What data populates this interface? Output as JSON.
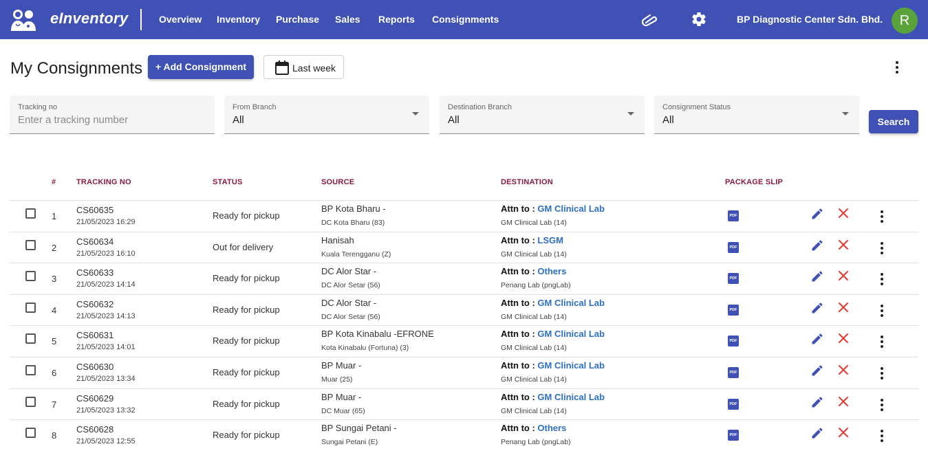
{
  "app": {
    "brand": "eInventory",
    "company": "BP Diagnostic Center Sdn. Bhd.",
    "avatar_initial": "R",
    "nav": [
      "Overview",
      "Inventory",
      "Purchase",
      "Sales",
      "Reports",
      "Consignments"
    ]
  },
  "page": {
    "title": "My Consignments",
    "add_button": "+ Add Consignment",
    "date_range": "Last week"
  },
  "filters": {
    "tracking_label": "Tracking no",
    "tracking_placeholder": "Enter a tracking number",
    "from_label": "From Branch",
    "from_value": "All",
    "dest_label": "Destination Branch",
    "dest_value": "All",
    "status_label": "Consignment Status",
    "status_value": "All",
    "search_button": "Search"
  },
  "table": {
    "headers": {
      "num": "#",
      "tracking": "TRACKING NO",
      "status": "STATUS",
      "source": "SOURCE",
      "destination": "DESTINATION",
      "slip": "PACKAGE SLIP"
    },
    "attn_prefix": "Attn to : ",
    "pdf_label": "PDF",
    "rows": [
      {
        "num": "1",
        "tracking": "CS60635",
        "date": "21/05/2023 16:29",
        "status": "Ready for pickup",
        "source": "BP Kota Bharu -",
        "source_branch": "DC Kota Bharu (83)",
        "attn": "GM Clinical Lab",
        "dest_branch": "GM Clinical Lab (14)"
      },
      {
        "num": "2",
        "tracking": "CS60634",
        "date": "21/05/2023 16:10",
        "status": "Out for delivery",
        "source": "Hanisah",
        "source_branch": "Kuala Terengganu (Z)",
        "attn": "LSGM",
        "dest_branch": "GM Clinical Lab (14)"
      },
      {
        "num": "3",
        "tracking": "CS60633",
        "date": "21/05/2023 14:14",
        "status": "Ready for pickup",
        "source": "DC Alor Star -",
        "source_branch": "DC Alor Setar (56)",
        "attn": "Others",
        "dest_branch": "Penang Lab (pngLab)"
      },
      {
        "num": "4",
        "tracking": "CS60632",
        "date": "21/05/2023 14:13",
        "status": "Ready for pickup",
        "source": "DC Alor Star -",
        "source_branch": "DC Alor Setar (56)",
        "attn": "GM Clinical Lab",
        "dest_branch": "GM Clinical Lab (14)"
      },
      {
        "num": "5",
        "tracking": "CS60631",
        "date": "21/05/2023 14:01",
        "status": "Ready for pickup",
        "source": "BP Kota Kinabalu -EFRONE",
        "source_branch": "Kota Kinabalu (Fortuna) (3)",
        "attn": "GM Clinical Lab",
        "dest_branch": "GM Clinical Lab (14)"
      },
      {
        "num": "6",
        "tracking": "CS60630",
        "date": "21/05/2023 13:34",
        "status": "Ready for pickup",
        "source": "BP Muar -",
        "source_branch": "Muar (25)",
        "attn": "GM Clinical Lab",
        "dest_branch": "GM Clinical Lab (14)"
      },
      {
        "num": "7",
        "tracking": "CS60629",
        "date": "21/05/2023 13:32",
        "status": "Ready for pickup",
        "source": "BP Muar -",
        "source_branch": "DC Muar (65)",
        "attn": "GM Clinical Lab",
        "dest_branch": "GM Clinical Lab (14)"
      },
      {
        "num": "8",
        "tracking": "CS60628",
        "date": "21/05/2023 12:55",
        "status": "Ready for pickup",
        "source": "BP Sungai Petani -",
        "source_branch": "Sungai Petani (E)",
        "attn": "Others",
        "dest_branch": "Penang Lab (pngLab)"
      }
    ]
  },
  "colors": {
    "primary": "#3f51b5",
    "header_text": "#8b1a3a",
    "link": "#2d6fc3",
    "delete": "#e53935",
    "avatar": "#5aa33b"
  }
}
